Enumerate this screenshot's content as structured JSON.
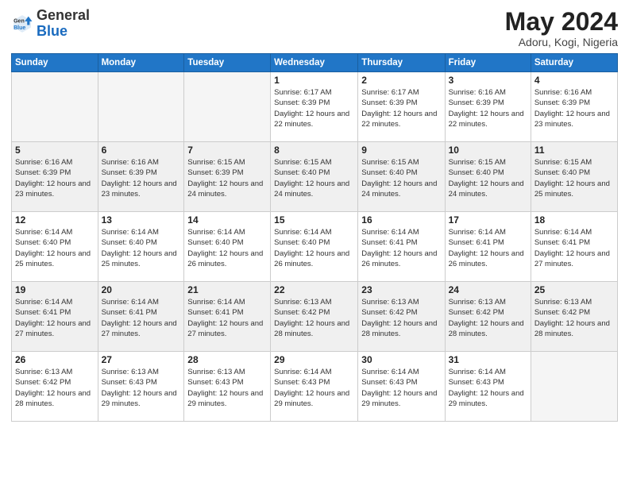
{
  "logo": {
    "general": "General",
    "blue": "Blue"
  },
  "title": {
    "month_year": "May 2024",
    "location": "Adoru, Kogi, Nigeria"
  },
  "weekdays": [
    "Sunday",
    "Monday",
    "Tuesday",
    "Wednesday",
    "Thursday",
    "Friday",
    "Saturday"
  ],
  "weeks": [
    [
      {
        "day": "",
        "info": ""
      },
      {
        "day": "",
        "info": ""
      },
      {
        "day": "",
        "info": ""
      },
      {
        "day": "1",
        "info": "Sunrise: 6:17 AM\nSunset: 6:39 PM\nDaylight: 12 hours and 22 minutes."
      },
      {
        "day": "2",
        "info": "Sunrise: 6:17 AM\nSunset: 6:39 PM\nDaylight: 12 hours and 22 minutes."
      },
      {
        "day": "3",
        "info": "Sunrise: 6:16 AM\nSunset: 6:39 PM\nDaylight: 12 hours and 22 minutes."
      },
      {
        "day": "4",
        "info": "Sunrise: 6:16 AM\nSunset: 6:39 PM\nDaylight: 12 hours and 23 minutes."
      }
    ],
    [
      {
        "day": "5",
        "info": "Sunrise: 6:16 AM\nSunset: 6:39 PM\nDaylight: 12 hours and 23 minutes."
      },
      {
        "day": "6",
        "info": "Sunrise: 6:16 AM\nSunset: 6:39 PM\nDaylight: 12 hours and 23 minutes."
      },
      {
        "day": "7",
        "info": "Sunrise: 6:15 AM\nSunset: 6:39 PM\nDaylight: 12 hours and 24 minutes."
      },
      {
        "day": "8",
        "info": "Sunrise: 6:15 AM\nSunset: 6:40 PM\nDaylight: 12 hours and 24 minutes."
      },
      {
        "day": "9",
        "info": "Sunrise: 6:15 AM\nSunset: 6:40 PM\nDaylight: 12 hours and 24 minutes."
      },
      {
        "day": "10",
        "info": "Sunrise: 6:15 AM\nSunset: 6:40 PM\nDaylight: 12 hours and 24 minutes."
      },
      {
        "day": "11",
        "info": "Sunrise: 6:15 AM\nSunset: 6:40 PM\nDaylight: 12 hours and 25 minutes."
      }
    ],
    [
      {
        "day": "12",
        "info": "Sunrise: 6:14 AM\nSunset: 6:40 PM\nDaylight: 12 hours and 25 minutes."
      },
      {
        "day": "13",
        "info": "Sunrise: 6:14 AM\nSunset: 6:40 PM\nDaylight: 12 hours and 25 minutes."
      },
      {
        "day": "14",
        "info": "Sunrise: 6:14 AM\nSunset: 6:40 PM\nDaylight: 12 hours and 26 minutes."
      },
      {
        "day": "15",
        "info": "Sunrise: 6:14 AM\nSunset: 6:40 PM\nDaylight: 12 hours and 26 minutes."
      },
      {
        "day": "16",
        "info": "Sunrise: 6:14 AM\nSunset: 6:41 PM\nDaylight: 12 hours and 26 minutes."
      },
      {
        "day": "17",
        "info": "Sunrise: 6:14 AM\nSunset: 6:41 PM\nDaylight: 12 hours and 26 minutes."
      },
      {
        "day": "18",
        "info": "Sunrise: 6:14 AM\nSunset: 6:41 PM\nDaylight: 12 hours and 27 minutes."
      }
    ],
    [
      {
        "day": "19",
        "info": "Sunrise: 6:14 AM\nSunset: 6:41 PM\nDaylight: 12 hours and 27 minutes."
      },
      {
        "day": "20",
        "info": "Sunrise: 6:14 AM\nSunset: 6:41 PM\nDaylight: 12 hours and 27 minutes."
      },
      {
        "day": "21",
        "info": "Sunrise: 6:14 AM\nSunset: 6:41 PM\nDaylight: 12 hours and 27 minutes."
      },
      {
        "day": "22",
        "info": "Sunrise: 6:13 AM\nSunset: 6:42 PM\nDaylight: 12 hours and 28 minutes."
      },
      {
        "day": "23",
        "info": "Sunrise: 6:13 AM\nSunset: 6:42 PM\nDaylight: 12 hours and 28 minutes."
      },
      {
        "day": "24",
        "info": "Sunrise: 6:13 AM\nSunset: 6:42 PM\nDaylight: 12 hours and 28 minutes."
      },
      {
        "day": "25",
        "info": "Sunrise: 6:13 AM\nSunset: 6:42 PM\nDaylight: 12 hours and 28 minutes."
      }
    ],
    [
      {
        "day": "26",
        "info": "Sunrise: 6:13 AM\nSunset: 6:42 PM\nDaylight: 12 hours and 28 minutes."
      },
      {
        "day": "27",
        "info": "Sunrise: 6:13 AM\nSunset: 6:43 PM\nDaylight: 12 hours and 29 minutes."
      },
      {
        "day": "28",
        "info": "Sunrise: 6:13 AM\nSunset: 6:43 PM\nDaylight: 12 hours and 29 minutes."
      },
      {
        "day": "29",
        "info": "Sunrise: 6:14 AM\nSunset: 6:43 PM\nDaylight: 12 hours and 29 minutes."
      },
      {
        "day": "30",
        "info": "Sunrise: 6:14 AM\nSunset: 6:43 PM\nDaylight: 12 hours and 29 minutes."
      },
      {
        "day": "31",
        "info": "Sunrise: 6:14 AM\nSunset: 6:43 PM\nDaylight: 12 hours and 29 minutes."
      },
      {
        "day": "",
        "info": ""
      }
    ]
  ]
}
